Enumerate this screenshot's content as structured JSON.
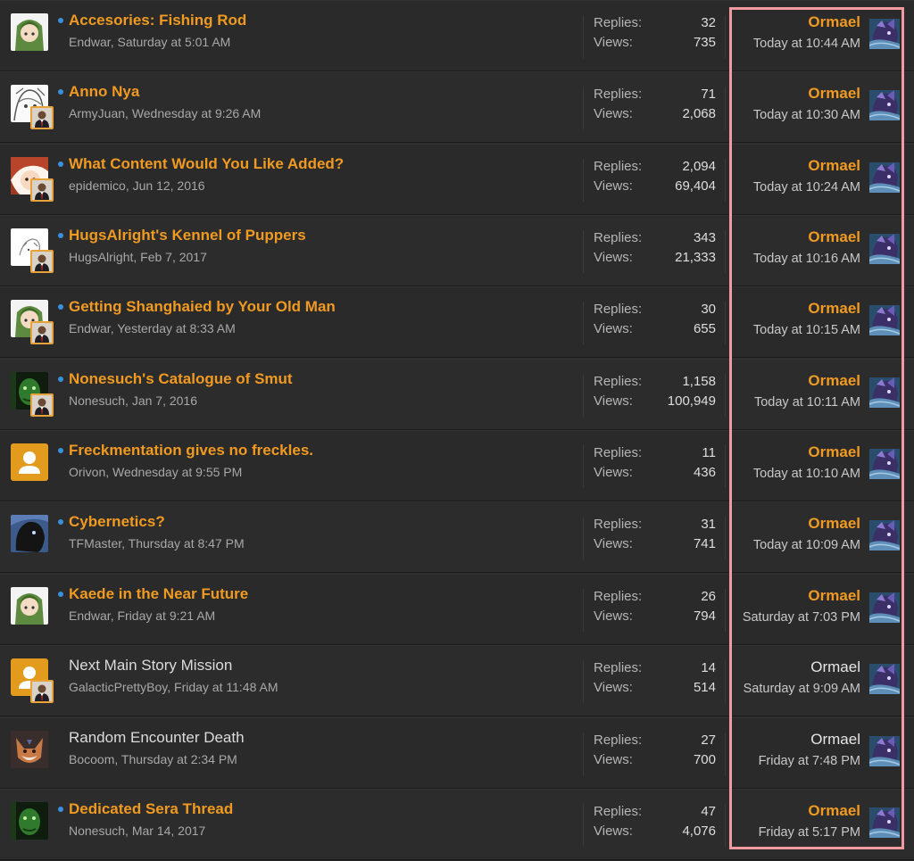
{
  "labels": {
    "replies": "Replies:",
    "views": "Views:"
  },
  "colors": {
    "unread_title": "#f09a22",
    "read_title": "#dcdcdc",
    "unread_dot": "#3b8fe0",
    "highlight": "#f19ba0"
  },
  "threads": [
    {
      "title": "Accesories: Fishing Rod",
      "author": "Endwar",
      "date": "Saturday at 5:01 AM",
      "replies": "32",
      "views": "735",
      "last_user": "Ormael",
      "last_date": "Today at 10:44 AM",
      "unread": true,
      "avatar": "green-hood-avatar-icon",
      "mini_avatar": false
    },
    {
      "title": "Anno Nya",
      "author": "ArmyJuan",
      "date": "Wednesday at 9:26 AM",
      "replies": "71",
      "views": "2,068",
      "last_user": "Ormael",
      "last_date": "Today at 10:30 AM",
      "unread": true,
      "avatar": "sketch-avatar-icon",
      "mini_avatar": true
    },
    {
      "title": "What Content Would You Like Added?",
      "author": "epidemico",
      "date": "Jun 12, 2016",
      "replies": "2,094",
      "views": "69,404",
      "last_user": "Ormael",
      "last_date": "Today at 10:24 AM",
      "unread": true,
      "avatar": "anime-avatar-icon",
      "mini_avatar": true
    },
    {
      "title": "HugsAlright's Kennel of Puppers",
      "author": "HugsAlright",
      "date": "Feb 7, 2017",
      "replies": "343",
      "views": "21,333",
      "last_user": "Ormael",
      "last_date": "Today at 10:16 AM",
      "unread": true,
      "avatar": "white-sketch-avatar-icon",
      "mini_avatar": true
    },
    {
      "title": "Getting Shanghaied by Your Old Man",
      "author": "Endwar",
      "date": "Yesterday at 8:33 AM",
      "replies": "30",
      "views": "655",
      "last_user": "Ormael",
      "last_date": "Today at 10:15 AM",
      "unread": true,
      "avatar": "green-hood-avatar-icon",
      "mini_avatar": true
    },
    {
      "title": "Nonesuch's Catalogue of Smut",
      "author": "Nonesuch",
      "date": "Jan 7, 2016",
      "replies": "1,158",
      "views": "100,949",
      "last_user": "Ormael",
      "last_date": "Today at 10:11 AM",
      "unread": true,
      "avatar": "green-face-avatar-icon",
      "mini_avatar": true
    },
    {
      "title": "Freckmentation gives no freckles.",
      "author": "Orivon",
      "date": "Wednesday at 9:55 PM",
      "replies": "11",
      "views": "436",
      "last_user": "Ormael",
      "last_date": "Today at 10:10 AM",
      "unread": true,
      "avatar": "default-user-avatar-icon",
      "mini_avatar": false
    },
    {
      "title": "Cybernetics?",
      "author": "TFMaster",
      "date": "Thursday at 8:47 PM",
      "replies": "31",
      "views": "741",
      "last_user": "Ormael",
      "last_date": "Today at 10:09 AM",
      "unread": true,
      "avatar": "dark-creature-avatar-icon",
      "mini_avatar": false
    },
    {
      "title": "Kaede in the Near Future",
      "author": "Endwar",
      "date": "Friday at 9:21 AM",
      "replies": "26",
      "views": "794",
      "last_user": "Ormael",
      "last_date": "Saturday at 7:03 PM",
      "unread": true,
      "avatar": "green-hood-avatar-icon",
      "mini_avatar": false
    },
    {
      "title": "Next Main Story Mission",
      "author": "GalacticPrettyBoy",
      "date": "Friday at 11:48 AM",
      "replies": "14",
      "views": "514",
      "last_user": "Ormael",
      "last_date": "Saturday at 9:09 AM",
      "unread": false,
      "avatar": "default-user-avatar-icon",
      "mini_avatar": true
    },
    {
      "title": "Random Encounter Death",
      "author": "Bocoom",
      "date": "Thursday at 2:34 PM",
      "replies": "27",
      "views": "700",
      "last_user": "Ormael",
      "last_date": "Friday at 7:48 PM",
      "unread": false,
      "avatar": "fox-avatar-icon",
      "mini_avatar": false
    },
    {
      "title": "Dedicated Sera Thread",
      "author": "Nonesuch",
      "date": "Mar 14, 2017",
      "replies": "47",
      "views": "4,076",
      "last_user": "Ormael",
      "last_date": "Friday at 5:17 PM",
      "unread": true,
      "avatar": "green-face-avatar-icon",
      "mini_avatar": false
    }
  ]
}
